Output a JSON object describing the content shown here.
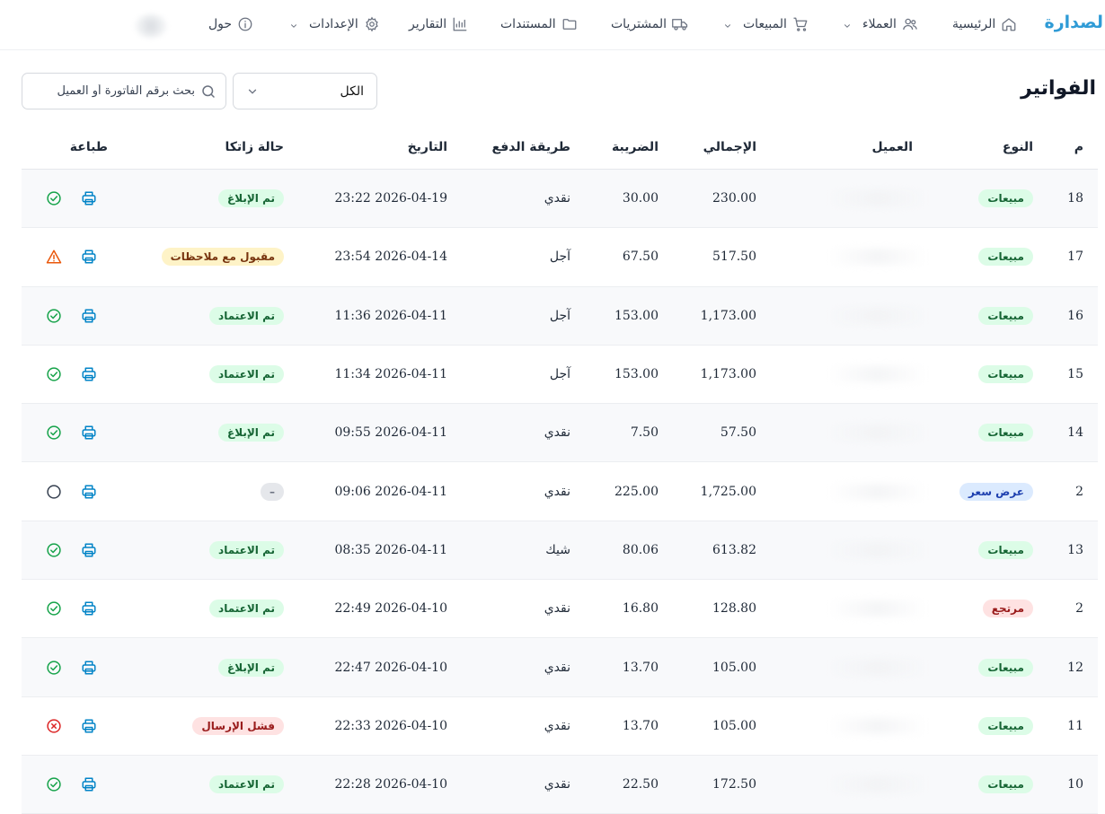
{
  "nav": {
    "brand": "لصدارة",
    "items": [
      {
        "label": "الرئيسية",
        "icon": "home-icon",
        "dropdown": false
      },
      {
        "label": "العملاء",
        "icon": "users-icon",
        "dropdown": true
      },
      {
        "label": "المبيعات",
        "icon": "cart-icon",
        "dropdown": true
      },
      {
        "label": "المشتريات",
        "icon": "truck-icon",
        "dropdown": false
      },
      {
        "label": "المستندات",
        "icon": "folder-icon",
        "dropdown": false
      },
      {
        "label": "التقارير",
        "icon": "chart-icon",
        "dropdown": false
      },
      {
        "label": "الإعدادات",
        "icon": "gear-icon",
        "dropdown": true
      },
      {
        "label": "حول",
        "icon": "info-icon",
        "dropdown": false
      }
    ]
  },
  "page": {
    "title": "الفواتير",
    "filter_value": "الكل",
    "search_placeholder": "بحث برقم الفاتورة أو العميل"
  },
  "table": {
    "headers": {
      "no": "م",
      "type": "النوع",
      "customer": "العميل",
      "total": "الإجمالي",
      "tax": "الضريبة",
      "payment": "طريقة الدفع",
      "date": "التاريخ",
      "zatca": "حالة زاتكا",
      "print": "طباعة"
    },
    "rows": [
      {
        "no": "18",
        "type": "مبيعات",
        "type_color": "green",
        "total": "230.00",
        "tax": "30.00",
        "payment": "نقدي",
        "date": "2026-04-19 23:22",
        "zatca": "تم الإبلاغ",
        "zatca_color": "green",
        "status_icon": "check-circle-icon"
      },
      {
        "no": "17",
        "type": "مبيعات",
        "type_color": "green",
        "total": "517.50",
        "tax": "67.50",
        "payment": "آجل",
        "date": "2026-04-14 23:54",
        "zatca": "مقبول مع ملاحظات",
        "zatca_color": "yellow",
        "status_icon": "warning-icon"
      },
      {
        "no": "16",
        "type": "مبيعات",
        "type_color": "green",
        "total": "1,173.00",
        "tax": "153.00",
        "payment": "آجل",
        "date": "2026-04-11 11:36",
        "zatca": "تم الاعتماد",
        "zatca_color": "green",
        "status_icon": "check-circle-icon"
      },
      {
        "no": "15",
        "type": "مبيعات",
        "type_color": "green",
        "total": "1,173.00",
        "tax": "153.00",
        "payment": "آجل",
        "date": "2026-04-11 11:34",
        "zatca": "تم الاعتماد",
        "zatca_color": "green",
        "status_icon": "check-circle-icon"
      },
      {
        "no": "14",
        "type": "مبيعات",
        "type_color": "green",
        "total": "57.50",
        "tax": "7.50",
        "payment": "نقدي",
        "date": "2026-04-11 09:55",
        "zatca": "تم الإبلاغ",
        "zatca_color": "green",
        "status_icon": "check-circle-icon"
      },
      {
        "no": "2",
        "type": "عرض سعر",
        "type_color": "blue",
        "total": "1,725.00",
        "tax": "225.00",
        "payment": "نقدي",
        "date": "2026-04-11 09:06",
        "zatca": "–",
        "zatca_color": "gray",
        "status_icon": "empty-circle-icon"
      },
      {
        "no": "13",
        "type": "مبيعات",
        "type_color": "green",
        "total": "613.82",
        "tax": "80.06",
        "payment": "شيك",
        "date": "2026-04-11 08:35",
        "zatca": "تم الاعتماد",
        "zatca_color": "green",
        "status_icon": "check-circle-icon"
      },
      {
        "no": "2",
        "type": "مرتجع",
        "type_color": "red",
        "total": "128.80",
        "tax": "16.80",
        "payment": "نقدي",
        "date": "2026-04-10 22:49",
        "zatca": "تم الاعتماد",
        "zatca_color": "green",
        "status_icon": "check-circle-icon"
      },
      {
        "no": "12",
        "type": "مبيعات",
        "type_color": "green",
        "total": "105.00",
        "tax": "13.70",
        "payment": "نقدي",
        "date": "2026-04-10 22:47",
        "zatca": "تم الإبلاغ",
        "zatca_color": "green",
        "status_icon": "check-circle-icon"
      },
      {
        "no": "11",
        "type": "مبيعات",
        "type_color": "green",
        "total": "105.00",
        "tax": "13.70",
        "payment": "نقدي",
        "date": "2026-04-10 22:33",
        "zatca": "فشل الإرسال",
        "zatca_color": "red",
        "status_icon": "x-circle-icon"
      },
      {
        "no": "10",
        "type": "مبيعات",
        "type_color": "green",
        "total": "172.50",
        "tax": "22.50",
        "payment": "نقدي",
        "date": "2026-04-10 22:28",
        "zatca": "تم الاعتماد",
        "zatca_color": "green",
        "status_icon": "check-circle-icon"
      }
    ]
  },
  "colors": {
    "brand": "#2f9bd6",
    "print_icon": "#0284c7",
    "ok": "#16a34a",
    "warn": "#ea580c",
    "error": "#dc2626"
  }
}
